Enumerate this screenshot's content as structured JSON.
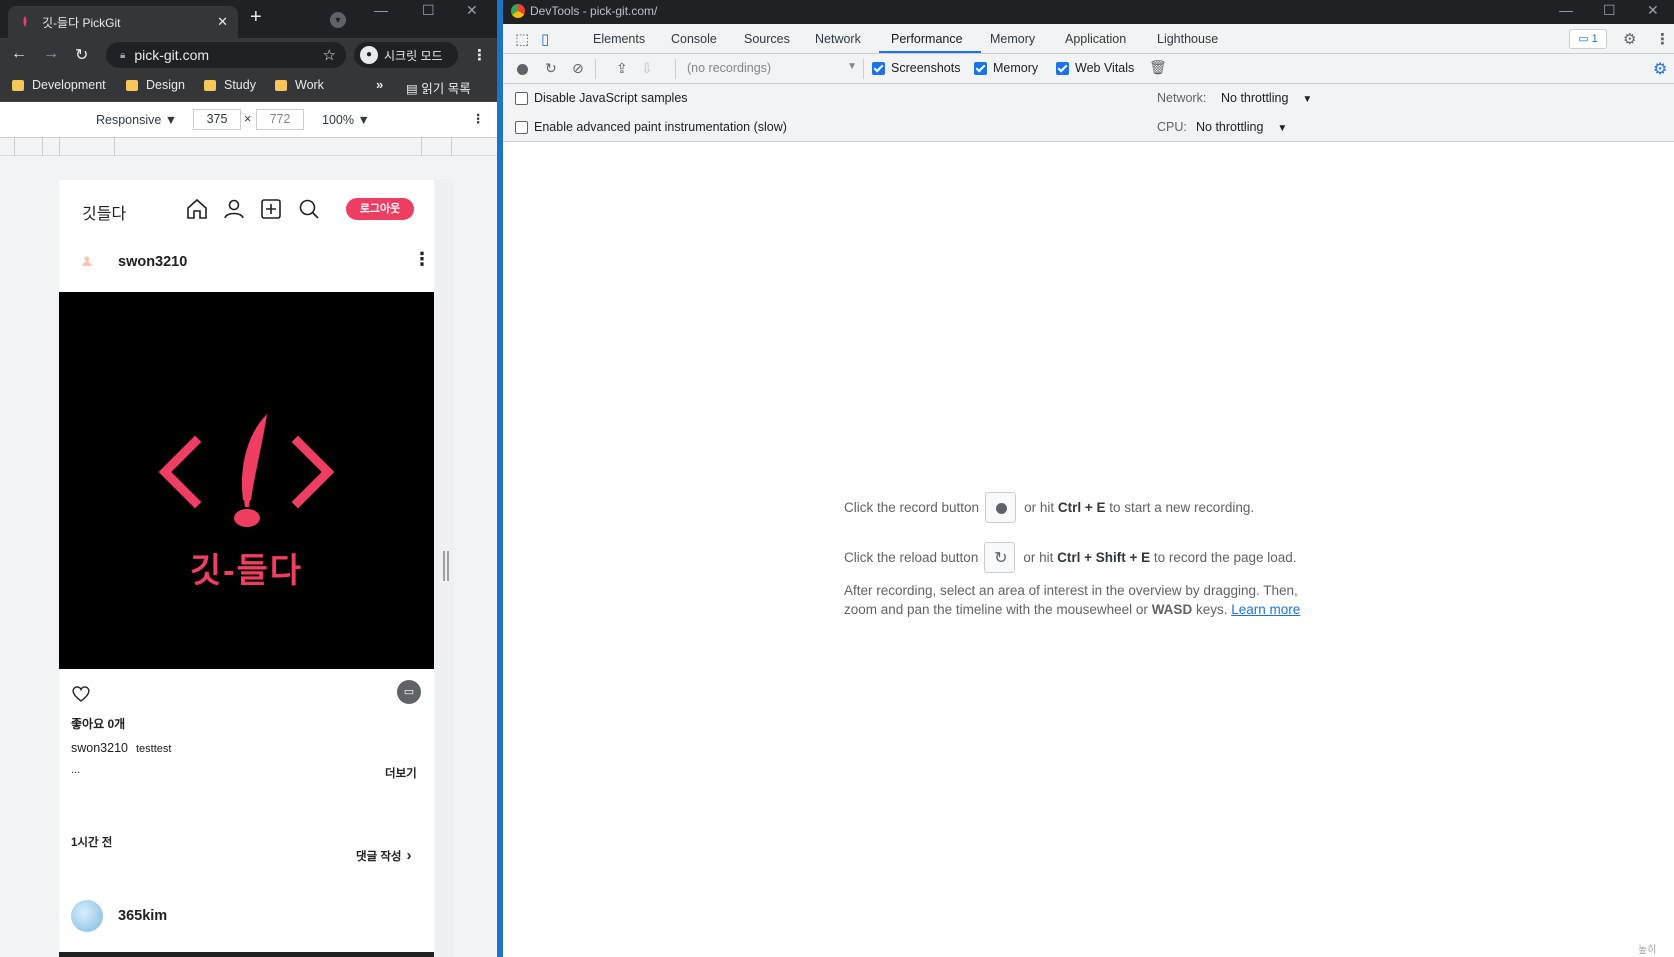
{
  "browser": {
    "tab_title": "깃-들다 PickGit",
    "url": "pick-git.com",
    "incognito_label": "시크릿 모드",
    "bookmarks": [
      "Development",
      "Design",
      "Study",
      "Work"
    ],
    "bookmarks_more": "»",
    "reading_list": "읽기 목록"
  },
  "device_toolbar": {
    "mode": "Responsive",
    "width": "375",
    "times": "×",
    "height": "772",
    "zoom": "100%"
  },
  "app": {
    "logo": "깃들다",
    "logout": "로그아웃",
    "post": {
      "username": "swon3210",
      "image_text": "깃-들다",
      "likes": "좋아요 0개",
      "author": "swon3210",
      "body": "testtest",
      "ellipsis": "...",
      "see_more": "더보기",
      "time": "1시간 전",
      "write_comment": "댓글 작성"
    },
    "next_post_username": "365kim"
  },
  "devtools": {
    "window_title": "DevTools - pick-git.com/",
    "tabs": [
      "Elements",
      "Console",
      "Sources",
      "Network",
      "Performance",
      "Memory",
      "Application",
      "Lighthouse"
    ],
    "active_tab": "Performance",
    "issues_count": "1",
    "recordings_placeholder": "(no recordings)",
    "checkboxes": {
      "screenshots": "Screenshots",
      "memory": "Memory",
      "web_vitals": "Web Vitals"
    },
    "settings": {
      "disable_js_samples": "Disable JavaScript samples",
      "advanced_paint": "Enable advanced paint instrumentation (slow)",
      "network_label": "Network:",
      "network_value": "No throttling",
      "cpu_label": "CPU:",
      "cpu_value": "No throttling"
    },
    "landing": {
      "record_pre": "Click the record button",
      "record_post": "or hit",
      "record_keys": "Ctrl + E",
      "record_end": "to start a new recording.",
      "reload_pre": "Click the reload button",
      "reload_post": "or hit",
      "reload_keys": "Ctrl + Shift + E",
      "reload_end": "to record the page load.",
      "after_1": "After recording, select an area of interest in the overview by dragging. Then, zoom and pan the timeline with the mousewheel or",
      "after_keys": "WASD",
      "after_2": "keys.",
      "learn_more": "Learn more"
    },
    "corner": "높히"
  }
}
